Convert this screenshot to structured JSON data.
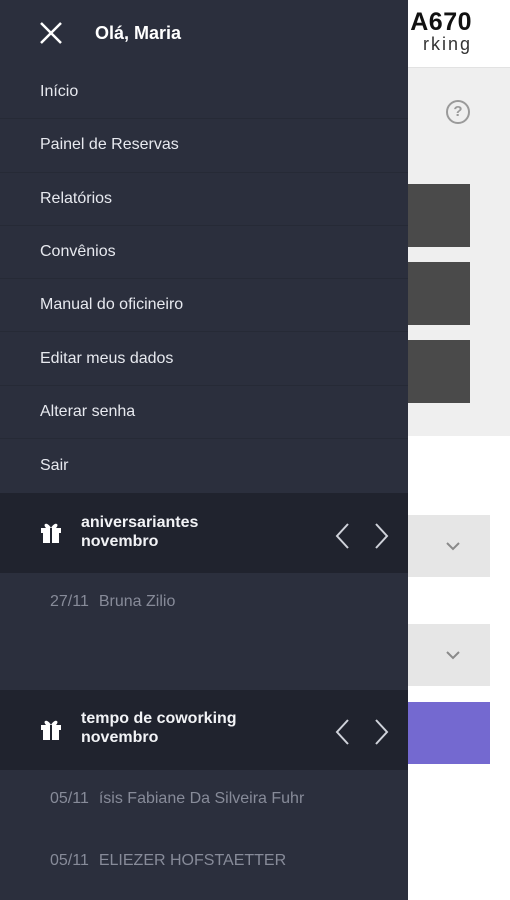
{
  "background": {
    "logo_top": "A670",
    "logo_bottom": "rking",
    "help_icon": "?"
  },
  "drawer": {
    "close_icon": "close-icon",
    "greeting": "Olá, Maria",
    "menu": [
      {
        "label": "Início"
      },
      {
        "label": "Painel de Reservas"
      },
      {
        "label": "Relatórios"
      },
      {
        "label": "Convênios"
      },
      {
        "label": "Manual do oficineiro"
      },
      {
        "label": "Editar meus dados"
      },
      {
        "label": "Alterar senha"
      },
      {
        "label": "Sair"
      }
    ],
    "birthdays": {
      "title_line1": "aniversariantes",
      "title_line2": "novembro",
      "entries": [
        {
          "date": "27/11",
          "name": "Bruna Zilio"
        }
      ]
    },
    "coworking": {
      "title_line1": "tempo de coworking",
      "title_line2": "novembro",
      "entries": [
        {
          "date": "05/11",
          "name": "ísis Fabiane Da Silveira Fuhr"
        },
        {
          "date": "05/11",
          "name": "ELIEZER HOFSTAETTER"
        }
      ]
    }
  },
  "colors": {
    "drawer_bg": "#2b2f3d",
    "section_bg": "#20232e",
    "accent_purple": "#7469d0"
  }
}
